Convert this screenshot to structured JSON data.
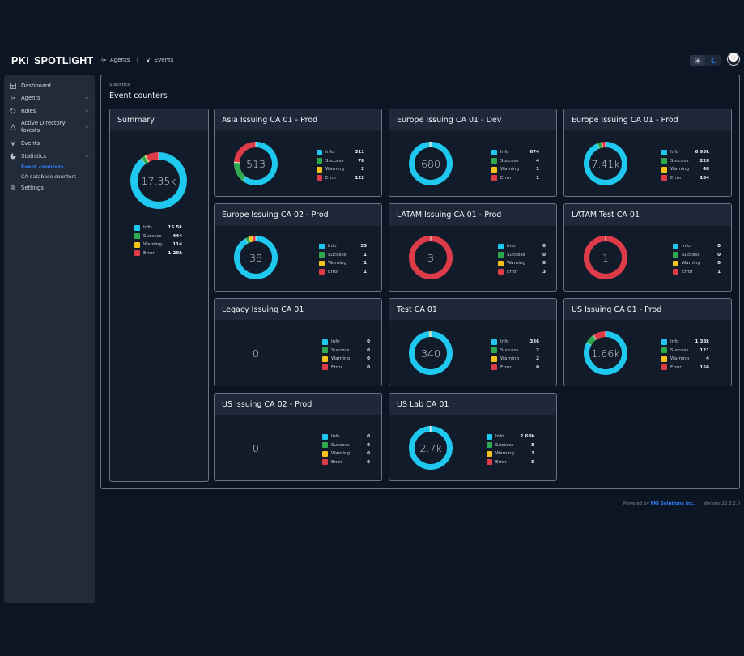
{
  "app": {
    "logo_bold": "PKI",
    "logo_text": "SPOTLIGHT",
    "top_nav": [
      {
        "label": "Agents",
        "icon": "agents-icon"
      },
      {
        "label": "Events",
        "icon": "events-icon"
      }
    ],
    "theme": {
      "light_icon": "sun-icon",
      "dark_icon": "moon-icon",
      "active": "light"
    }
  },
  "sidebar": {
    "items": [
      {
        "label": "Dashboard",
        "icon": "dashboard-icon",
        "expandable": false
      },
      {
        "label": "Agents",
        "icon": "agents-icon",
        "expandable": true
      },
      {
        "label": "Roles",
        "icon": "tag-icon",
        "expandable": true
      },
      {
        "label": "Active Directory forests",
        "icon": "triangle-icon",
        "expandable": true
      },
      {
        "label": "Events",
        "icon": "events-icon",
        "expandable": false
      },
      {
        "label": "Statistics",
        "icon": "pie-icon",
        "expandable": true
      },
      {
        "label": "Settings",
        "icon": "gear-icon",
        "expandable": false
      }
    ],
    "statistics_sub": [
      {
        "label": "Event counters",
        "active": true
      },
      {
        "label": "CA database counters",
        "active": false
      }
    ]
  },
  "page": {
    "breadcrumb": "Statistics",
    "title": "Event counters"
  },
  "colors": {
    "info": "#1ec8ef",
    "success": "#2fa84f",
    "warning": "#f5c21b",
    "error": "#dc3c48",
    "accent": "#2f7cf6"
  },
  "legend_labels": {
    "info": "Info",
    "success": "Success",
    "warning": "Warning",
    "error": "Error"
  },
  "chart_data": [
    {
      "type": "pie",
      "title": "Summary",
      "center_label": "17.35k",
      "categories": [
        "Info",
        "Success",
        "Warning",
        "Error"
      ],
      "values": [
        15500,
        444,
        114,
        1290
      ],
      "value_labels": [
        "15.5k",
        "444",
        "114",
        "1.29k"
      ]
    },
    {
      "type": "pie",
      "title": "Asia Issuing CA 01 - Prod",
      "center_label": "513",
      "categories": [
        "Info",
        "Success",
        "Warning",
        "Error"
      ],
      "values": [
        311,
        78,
        2,
        122
      ],
      "value_labels": [
        "311",
        "78",
        "2",
        "122"
      ]
    },
    {
      "type": "pie",
      "title": "Europe Issuing CA 01 - Dev",
      "center_label": "680",
      "categories": [
        "Info",
        "Success",
        "Warning",
        "Error"
      ],
      "values": [
        674,
        4,
        1,
        1
      ],
      "value_labels": [
        "674",
        "4",
        "1",
        "1"
      ]
    },
    {
      "type": "pie",
      "title": "Europe Issuing CA 01 - Prod",
      "center_label": "7.41k",
      "categories": [
        "Info",
        "Success",
        "Warning",
        "Error"
      ],
      "values": [
        6950,
        228,
        48,
        184
      ],
      "value_labels": [
        "6.95k",
        "228",
        "48",
        "184"
      ]
    },
    {
      "type": "pie",
      "title": "Europe Issuing CA 02 - Prod",
      "center_label": "38",
      "categories": [
        "Info",
        "Success",
        "Warning",
        "Error"
      ],
      "values": [
        35,
        1,
        1,
        1
      ],
      "value_labels": [
        "35",
        "1",
        "1",
        "1"
      ]
    },
    {
      "type": "pie",
      "title": "LATAM Issuing CA 01 - Prod",
      "center_label": "3",
      "categories": [
        "Info",
        "Success",
        "Warning",
        "Error"
      ],
      "values": [
        0,
        0,
        0,
        3
      ],
      "value_labels": [
        "0",
        "0",
        "0",
        "3"
      ]
    },
    {
      "type": "pie",
      "title": "LATAM Test CA 01",
      "center_label": "1",
      "categories": [
        "Info",
        "Success",
        "Warning",
        "Error"
      ],
      "values": [
        0,
        0,
        0,
        1
      ],
      "value_labels": [
        "0",
        "0",
        "0",
        "1"
      ]
    },
    {
      "type": "pie",
      "title": "Legacy Issuing CA 01",
      "center_label": "0",
      "categories": [
        "Info",
        "Success",
        "Warning",
        "Error"
      ],
      "values": [
        0,
        0,
        0,
        0
      ],
      "value_labels": [
        "0",
        "0",
        "0",
        "0"
      ]
    },
    {
      "type": "pie",
      "title": "Test CA 01",
      "center_label": "340",
      "categories": [
        "Info",
        "Success",
        "Warning",
        "Error"
      ],
      "values": [
        336,
        2,
        2,
        0
      ],
      "value_labels": [
        "336",
        "2",
        "2",
        "0"
      ]
    },
    {
      "type": "pie",
      "title": "US Issuing CA 01 - Prod",
      "center_label": "1.66k",
      "categories": [
        "Info",
        "Success",
        "Warning",
        "Error"
      ],
      "values": [
        1380,
        121,
        4,
        156
      ],
      "value_labels": [
        "1.38k",
        "121",
        "4",
        "156"
      ]
    },
    {
      "type": "pie",
      "title": "US Issuing CA 02 - Prod",
      "center_label": "0",
      "categories": [
        "Info",
        "Success",
        "Warning",
        "Error"
      ],
      "values": [
        0,
        0,
        0,
        0
      ],
      "value_labels": [
        "0",
        "0",
        "0",
        "0"
      ]
    },
    {
      "type": "pie",
      "title": "US Lab CA 01",
      "center_label": "2.7k",
      "categories": [
        "Info",
        "Success",
        "Warning",
        "Error"
      ],
      "values": [
        2680,
        8,
        1,
        5
      ],
      "value_labels": [
        "2.68k",
        "8",
        "1",
        "5"
      ]
    }
  ],
  "footer": {
    "powered_by": "Powered by",
    "company": "PKI Solutions Inc.",
    "separator": "·",
    "version": "Version 22.3.2.0"
  }
}
